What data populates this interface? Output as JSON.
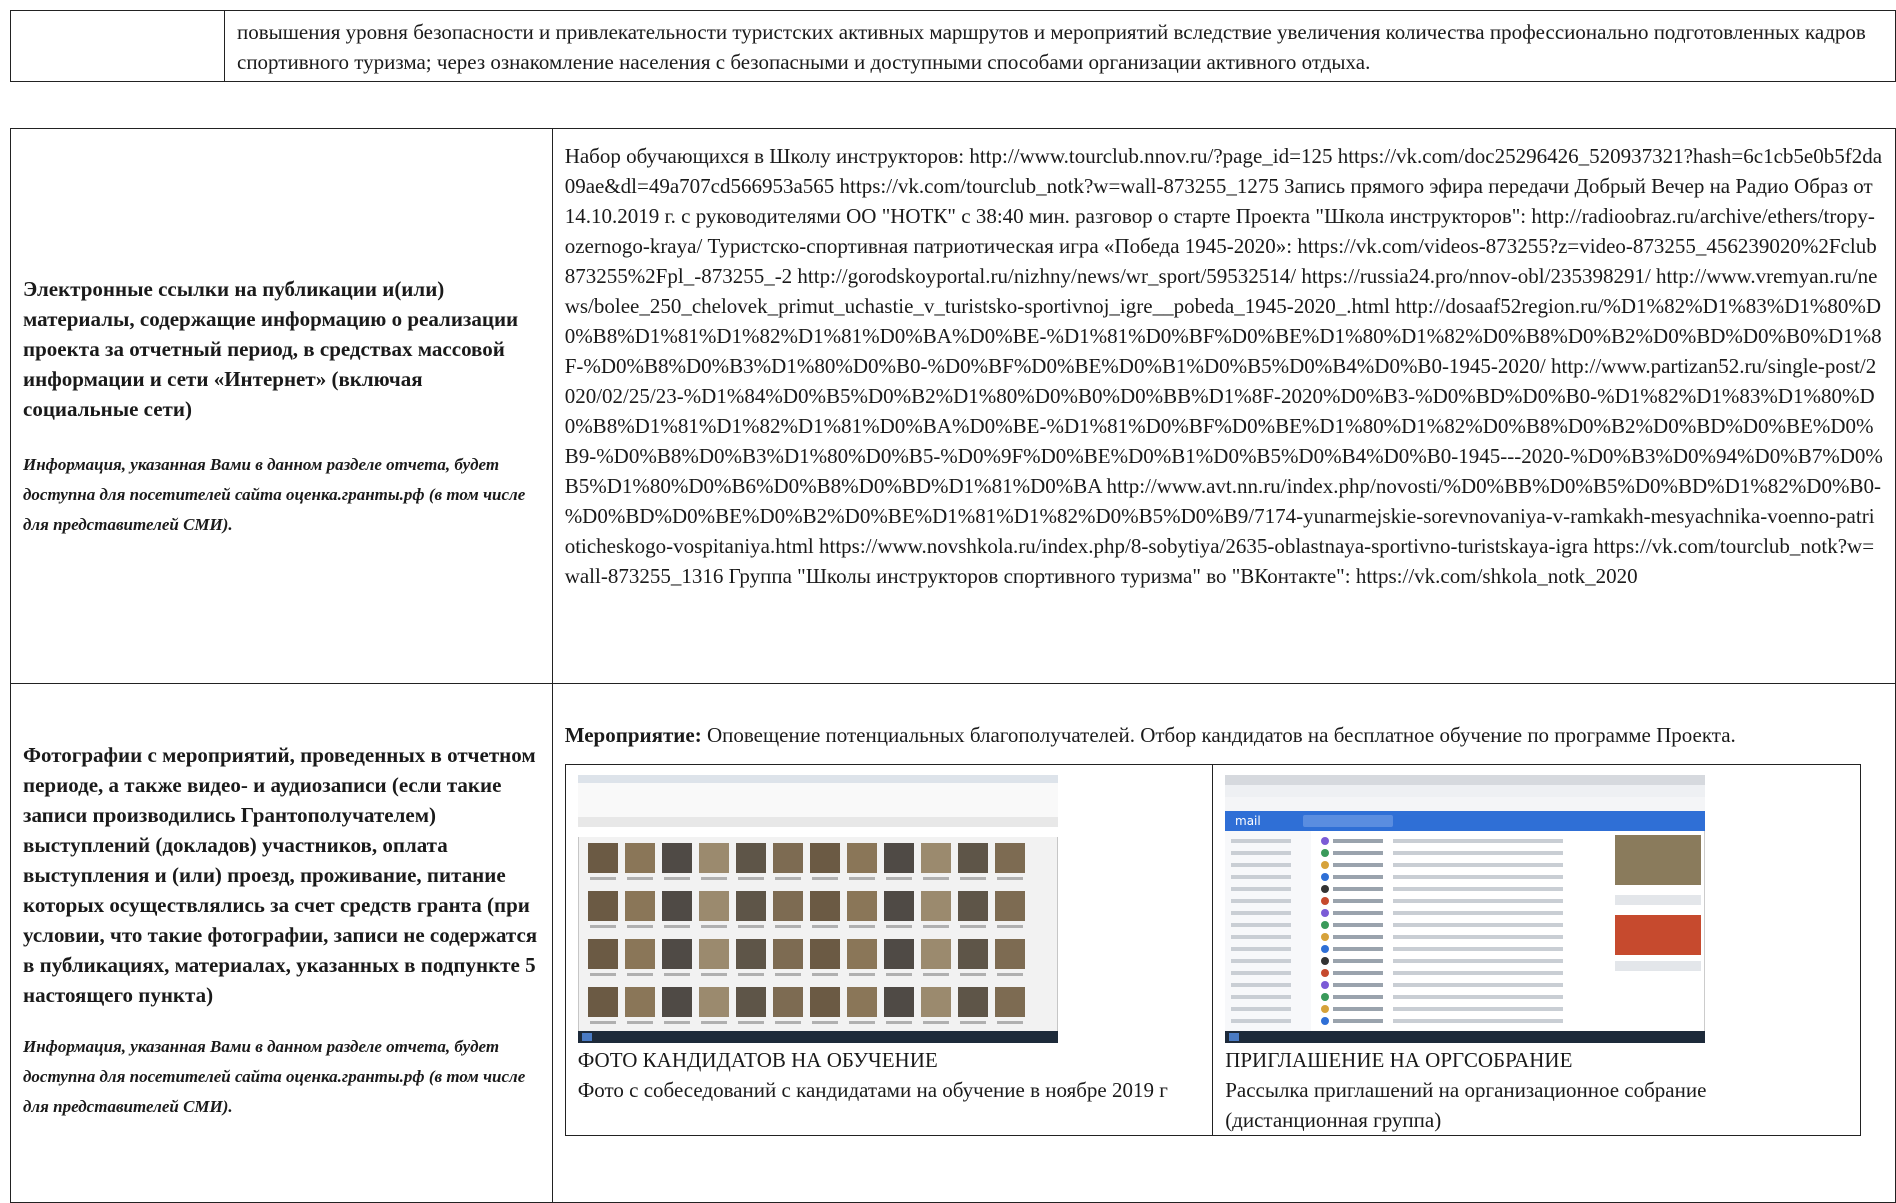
{
  "top_row": {
    "text": "повышения уровня безопасности и привлекательности туристских активных маршрутов и мероприятий вследствие увеличения количества профессионально подготовленных кадров спортивного туризма; через ознакомление населения с безопасными и доступными способами организации активного отдыха."
  },
  "links_row": {
    "heading": "Электронные ссылки на публикации и(или) материалы, содержащие информацию о реализации проекта за отчетный период, в средствах массовой информации и сети «Интернет» (включая социальные сети)",
    "note": "Информация, указанная Вами в данном разделе отчета, будет доступна для посетителей сайта оценка.гранты.рф (в том числе для представителей СМИ).",
    "content": "Набор обучающихся в Школу инструкторов: http://www.tourclub.nnov.ru/?page_id=125 https://vk.com/doc25296426_520937321?hash=6c1cb5e0b5f2da09ae&dl=49a707cd566953a565 https://vk.com/tourclub_notk?w=wall-873255_1275 Запись прямого эфира передачи Добрый Вечер на Радио Образ от 14.10.2019 г. с руководителями ОО \"НОТК\" с 38:40 мин. разговор о старте Проекта \"Школа инструкторов\": http://radioobraz.ru/archive/ethers/tropy-ozernogo-kraya/ Туристско-спортивная патриотическая игра «Победа 1945-2020»: https://vk.com/videos-873255?z=video-873255_456239020%2Fclub873255%2Fpl_-873255_-2 http://gorodskoyportal.ru/nizhny/news/wr_sport/59532514/ https://russia24.pro/nnov-obl/235398291/ http://www.vremyan.ru/news/bolee_250_chelovek_primut_uchastie_v_turistsko-sportivnoj_igre__pobeda_1945-2020_.html http://dosaaf52region.ru/%D1%82%D1%83%D1%80%D0%B8%D1%81%D1%82%D1%81%D0%BA%D0%BE-%D1%81%D0%BF%D0%BE%D1%80%D1%82%D0%B8%D0%B2%D0%BD%D0%B0%D1%8F-%D0%B8%D0%B3%D1%80%D0%B0-%D0%BF%D0%BE%D0%B1%D0%B5%D0%B4%D0%B0-1945-2020/ http://www.partizan52.ru/single-post/2020/02/25/23-%D1%84%D0%B5%D0%B2%D1%80%D0%B0%D0%BB%D1%8F-2020%D0%B3-%D0%BD%D0%B0-%D1%82%D1%83%D1%80%D0%B8%D1%81%D1%82%D1%81%D0%BA%D0%BE-%D1%81%D0%BF%D0%BE%D1%80%D1%82%D0%B8%D0%B2%D0%BD%D0%BE%D0%B9-%D0%B8%D0%B3%D1%80%D0%B5-%D0%9F%D0%BE%D0%B1%D0%B5%D0%B4%D0%B0-1945---2020-%D0%B3%D0%94%D0%B7%D0%B5%D1%80%D0%B6%D0%B8%D0%BD%D1%81%D0%BA http://www.avt.nn.ru/index.php/novosti/%D0%BB%D0%B5%D0%BD%D1%82%D0%B0-%D0%BD%D0%BE%D0%B2%D0%BE%D1%81%D1%82%D0%B5%D0%B9/7174-yunarmejskie-sorevnovaniya-v-ramkakh-mesyachnika-voenno-patrioticheskogo-vospitaniya.html https://www.novshkola.ru/index.php/8-sobytiya/2635-oblastnaya-sportivno-turistskaya-igra https://vk.com/tourclub_notk?w=wall-873255_1316 Группа \"Школы инструкторов спортивного туризма\" во \"ВКонтакте\": https://vk.com/shkola_notk_2020"
  },
  "photos_row": {
    "heading": "Фотографии с мероприятий, проведенных в отчетном периоде, а также видео- и аудиозаписи (если такие записи производились Грантополучателем) выступлений (докладов) участников, оплата выступления и (или) проезд, проживание, питание которых осуществлялись за счет средств гранта (при условии, что такие фотографии, записи не содержатся в публикациях, материалах, указанных в подпункте 5 настоящего пункта)",
    "note": "Информация, указанная Вами в данном разделе отчета, будет доступна для посетителей сайта оценка.гранты.рф (в том числе для представителей СМИ).",
    "event_label": "Мероприятие:",
    "event_text": " Оповещение потенциальных благополучателей. Отбор кандидатов на бесплатное обучение по программе Проекта.",
    "photos": [
      {
        "title": "ФОТО КАНДИДАТОВ НА ОБУЧЕНИЕ",
        "caption": "Фото с собеседований с кандидатами на обучение в ноябре 2019 г"
      },
      {
        "title": "ПРИГЛАШЕНИЕ НА ОРГСОБРАНИЕ",
        "caption": "Рассылка приглашений на организационное собрание (дистанционная группа)"
      }
    ],
    "mail_logo": "mail"
  }
}
